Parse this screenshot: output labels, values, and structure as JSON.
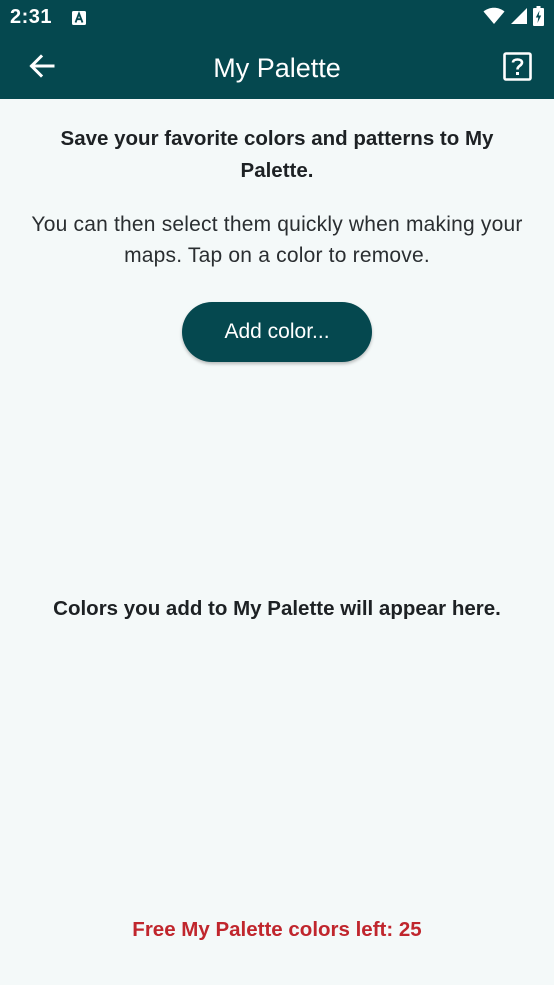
{
  "status_bar": {
    "time": "2:31",
    "notification_icon": "text-a-icon",
    "wifi_icon": "wifi-icon",
    "signal_icon": "signal-icon",
    "battery_icon": "battery-charging-icon"
  },
  "app_bar": {
    "title": "My Palette",
    "back_icon": "arrow-left-icon",
    "help_icon": "help-box-icon",
    "color": "#05484f"
  },
  "intro": {
    "heading": "Save your favorite colors and patterns to My Palette.",
    "body": "You can then select them quickly when making your maps. Tap on a color to remove."
  },
  "add_color_button": {
    "label": "Add color..."
  },
  "empty_state": {
    "message": "Colors you add to My Palette will appear here."
  },
  "footer": {
    "free_count_text": "Free My Palette colors left: 25",
    "color": "#c0262d"
  }
}
